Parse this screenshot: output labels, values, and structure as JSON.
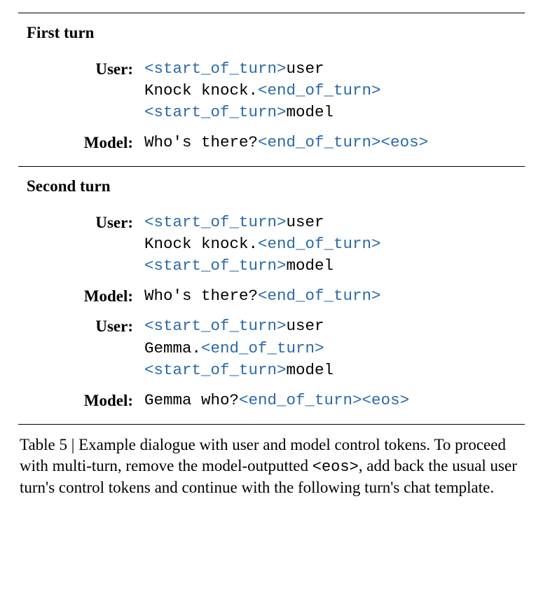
{
  "table": {
    "turn1": {
      "header": "First turn",
      "user": {
        "label": "User:",
        "l1_tok": "<start_of_turn>",
        "l1_plain": "user",
        "l2_plain": "Knock knock.",
        "l2_tok": "<end_of_turn>",
        "l3_tok": "<start_of_turn>",
        "l3_plain": "model"
      },
      "model": {
        "label": "Model:",
        "plain": "Who's there?",
        "tok": "<end_of_turn><eos>"
      }
    },
    "turn2": {
      "header": "Second turn",
      "user1": {
        "label": "User:",
        "l1_tok": "<start_of_turn>",
        "l1_plain": "user",
        "l2_plain": "Knock knock.",
        "l2_tok": "<end_of_turn>",
        "l3_tok": "<start_of_turn>",
        "l3_plain": "model"
      },
      "model1": {
        "label": "Model:",
        "plain": "Who's there?",
        "tok": "<end_of_turn>"
      },
      "user2": {
        "label": "User:",
        "l1_tok": "<start_of_turn>",
        "l1_plain": "user",
        "l2_plain": "Gemma.",
        "l2_tok": "<end_of_turn>",
        "l3_tok": "<start_of_turn>",
        "l3_plain": "model"
      },
      "model2": {
        "label": "Model:",
        "plain": "Gemma who?",
        "tok": "<end_of_turn><eos>"
      }
    }
  },
  "caption": {
    "prefix": "Table 5 | Example dialogue with user and model control tokens. To proceed with multi-turn, remove the model-outputted ",
    "eos": "<eos>",
    "suffix": ", add back the usual user turn's control tokens and continue with the following turn's chat template."
  }
}
